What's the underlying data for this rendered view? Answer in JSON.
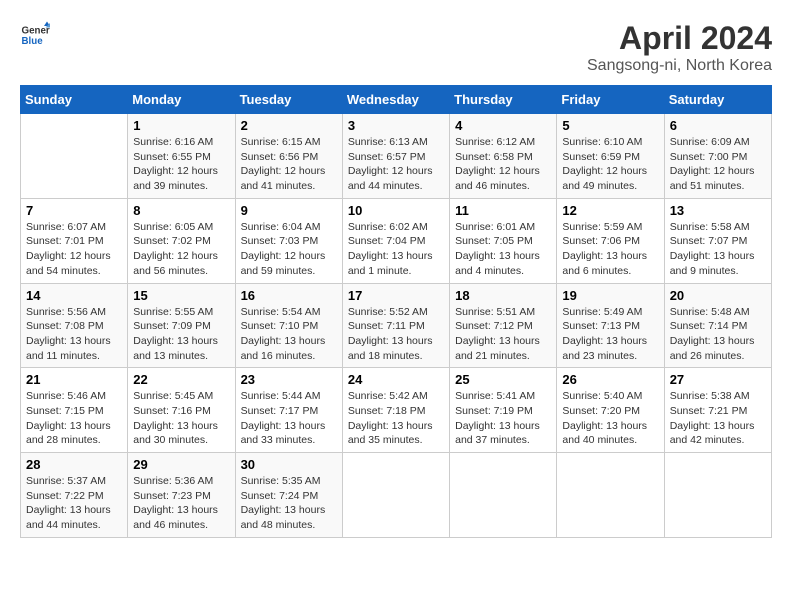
{
  "logo": {
    "line1": "General",
    "line2": "Blue"
  },
  "title": "April 2024",
  "subtitle": "Sangsong-ni, North Korea",
  "days_header": [
    "Sunday",
    "Monday",
    "Tuesday",
    "Wednesday",
    "Thursday",
    "Friday",
    "Saturday"
  ],
  "weeks": [
    [
      {
        "num": "",
        "info": ""
      },
      {
        "num": "1",
        "info": "Sunrise: 6:16 AM\nSunset: 6:55 PM\nDaylight: 12 hours\nand 39 minutes."
      },
      {
        "num": "2",
        "info": "Sunrise: 6:15 AM\nSunset: 6:56 PM\nDaylight: 12 hours\nand 41 minutes."
      },
      {
        "num": "3",
        "info": "Sunrise: 6:13 AM\nSunset: 6:57 PM\nDaylight: 12 hours\nand 44 minutes."
      },
      {
        "num": "4",
        "info": "Sunrise: 6:12 AM\nSunset: 6:58 PM\nDaylight: 12 hours\nand 46 minutes."
      },
      {
        "num": "5",
        "info": "Sunrise: 6:10 AM\nSunset: 6:59 PM\nDaylight: 12 hours\nand 49 minutes."
      },
      {
        "num": "6",
        "info": "Sunrise: 6:09 AM\nSunset: 7:00 PM\nDaylight: 12 hours\nand 51 minutes."
      }
    ],
    [
      {
        "num": "7",
        "info": "Sunrise: 6:07 AM\nSunset: 7:01 PM\nDaylight: 12 hours\nand 54 minutes."
      },
      {
        "num": "8",
        "info": "Sunrise: 6:05 AM\nSunset: 7:02 PM\nDaylight: 12 hours\nand 56 minutes."
      },
      {
        "num": "9",
        "info": "Sunrise: 6:04 AM\nSunset: 7:03 PM\nDaylight: 12 hours\nand 59 minutes."
      },
      {
        "num": "10",
        "info": "Sunrise: 6:02 AM\nSunset: 7:04 PM\nDaylight: 13 hours\nand 1 minute."
      },
      {
        "num": "11",
        "info": "Sunrise: 6:01 AM\nSunset: 7:05 PM\nDaylight: 13 hours\nand 4 minutes."
      },
      {
        "num": "12",
        "info": "Sunrise: 5:59 AM\nSunset: 7:06 PM\nDaylight: 13 hours\nand 6 minutes."
      },
      {
        "num": "13",
        "info": "Sunrise: 5:58 AM\nSunset: 7:07 PM\nDaylight: 13 hours\nand 9 minutes."
      }
    ],
    [
      {
        "num": "14",
        "info": "Sunrise: 5:56 AM\nSunset: 7:08 PM\nDaylight: 13 hours\nand 11 minutes."
      },
      {
        "num": "15",
        "info": "Sunrise: 5:55 AM\nSunset: 7:09 PM\nDaylight: 13 hours\nand 13 minutes."
      },
      {
        "num": "16",
        "info": "Sunrise: 5:54 AM\nSunset: 7:10 PM\nDaylight: 13 hours\nand 16 minutes."
      },
      {
        "num": "17",
        "info": "Sunrise: 5:52 AM\nSunset: 7:11 PM\nDaylight: 13 hours\nand 18 minutes."
      },
      {
        "num": "18",
        "info": "Sunrise: 5:51 AM\nSunset: 7:12 PM\nDaylight: 13 hours\nand 21 minutes."
      },
      {
        "num": "19",
        "info": "Sunrise: 5:49 AM\nSunset: 7:13 PM\nDaylight: 13 hours\nand 23 minutes."
      },
      {
        "num": "20",
        "info": "Sunrise: 5:48 AM\nSunset: 7:14 PM\nDaylight: 13 hours\nand 26 minutes."
      }
    ],
    [
      {
        "num": "21",
        "info": "Sunrise: 5:46 AM\nSunset: 7:15 PM\nDaylight: 13 hours\nand 28 minutes."
      },
      {
        "num": "22",
        "info": "Sunrise: 5:45 AM\nSunset: 7:16 PM\nDaylight: 13 hours\nand 30 minutes."
      },
      {
        "num": "23",
        "info": "Sunrise: 5:44 AM\nSunset: 7:17 PM\nDaylight: 13 hours\nand 33 minutes."
      },
      {
        "num": "24",
        "info": "Sunrise: 5:42 AM\nSunset: 7:18 PM\nDaylight: 13 hours\nand 35 minutes."
      },
      {
        "num": "25",
        "info": "Sunrise: 5:41 AM\nSunset: 7:19 PM\nDaylight: 13 hours\nand 37 minutes."
      },
      {
        "num": "26",
        "info": "Sunrise: 5:40 AM\nSunset: 7:20 PM\nDaylight: 13 hours\nand 40 minutes."
      },
      {
        "num": "27",
        "info": "Sunrise: 5:38 AM\nSunset: 7:21 PM\nDaylight: 13 hours\nand 42 minutes."
      }
    ],
    [
      {
        "num": "28",
        "info": "Sunrise: 5:37 AM\nSunset: 7:22 PM\nDaylight: 13 hours\nand 44 minutes."
      },
      {
        "num": "29",
        "info": "Sunrise: 5:36 AM\nSunset: 7:23 PM\nDaylight: 13 hours\nand 46 minutes."
      },
      {
        "num": "30",
        "info": "Sunrise: 5:35 AM\nSunset: 7:24 PM\nDaylight: 13 hours\nand 48 minutes."
      },
      {
        "num": "",
        "info": ""
      },
      {
        "num": "",
        "info": ""
      },
      {
        "num": "",
        "info": ""
      },
      {
        "num": "",
        "info": ""
      }
    ]
  ]
}
